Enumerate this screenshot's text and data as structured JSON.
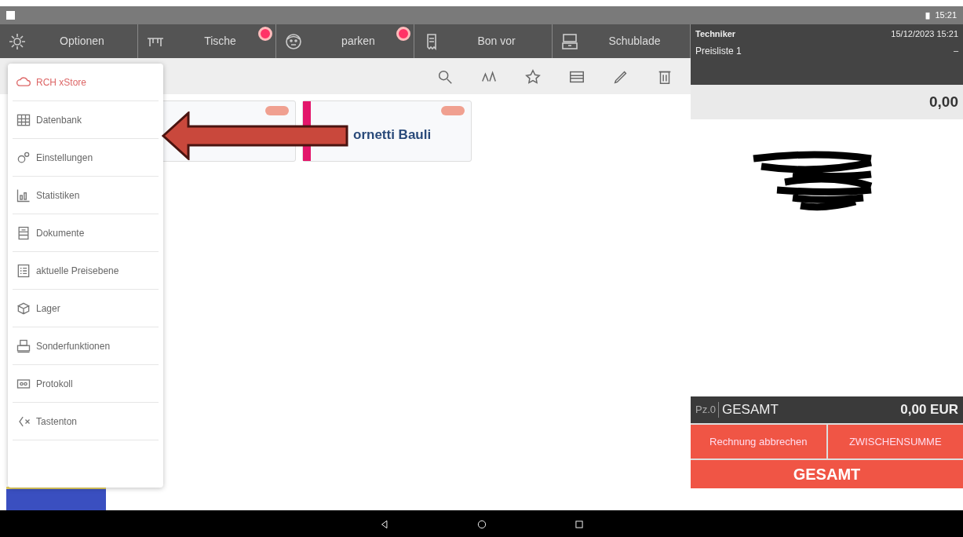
{
  "status_bar": {
    "time": "15:21"
  },
  "toolbar": [
    {
      "label": "Optionen",
      "badge": false
    },
    {
      "label": "Tische",
      "badge": true
    },
    {
      "label": "parken",
      "badge": true
    },
    {
      "label": "Bon vor",
      "badge": false
    },
    {
      "label": "Schublade",
      "badge": false
    }
  ],
  "menu": {
    "items": [
      {
        "label": "RCH xStore",
        "selected": true
      },
      {
        "label": "Datenbank",
        "selected": false
      },
      {
        "label": "Einstellungen",
        "selected": false
      },
      {
        "label": "Statistiken",
        "selected": false
      },
      {
        "label": "Dokumente",
        "selected": false
      },
      {
        "label": "aktuelle Preisebene",
        "selected": false
      },
      {
        "label": "Lager",
        "selected": false
      },
      {
        "label": "Sonderfunktionen",
        "selected": false
      },
      {
        "label": "Protokoll",
        "selected": false
      },
      {
        "label": "Tastenton",
        "selected": false
      }
    ]
  },
  "products": [
    {
      "striped": false
    },
    {
      "striped": true,
      "name": "ornetti Bauli"
    }
  ],
  "receipt": {
    "operator": "Techniker",
    "datetime": "15/12/2023 15:21",
    "price_list": "Preisliste 1",
    "dash": "–",
    "amount": "0,00",
    "pieces": "Pz.0",
    "total_label": "GESAMT",
    "total": "0,00 EUR",
    "buttons": [
      "Rechnung abbrechen",
      "ZWISCHENSUMME"
    ],
    "pay_button": "GESAMT"
  }
}
